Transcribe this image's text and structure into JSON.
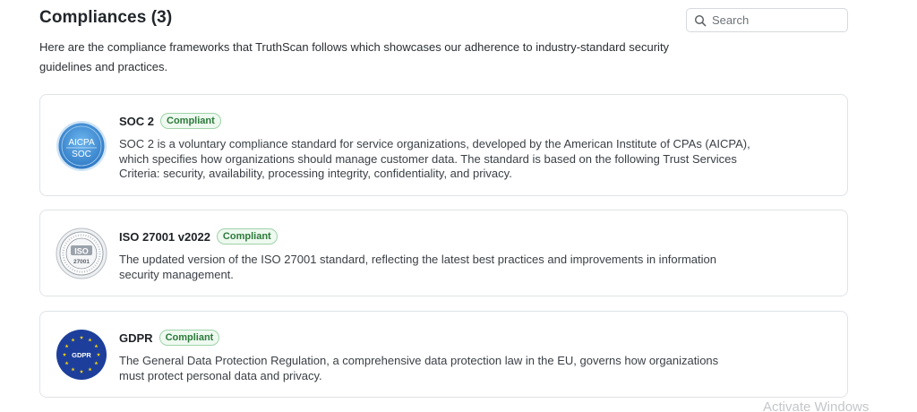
{
  "header": {
    "title": "Compliances (3)",
    "intro": "Here are the compliance frameworks that TruthScan follows which showcases our adherence to industry-standard security guidelines and practices."
  },
  "search": {
    "placeholder": "Search",
    "value": ""
  },
  "compliances": [
    {
      "name": "SOC 2",
      "status": "Compliant",
      "logo_icon": "aicpa-soc-seal-icon",
      "logo_text_top": "AICPA",
      "logo_text_bottom": "SOC",
      "description": "SOC 2 is a voluntary compliance standard for service organizations, developed by the American Institute of CPAs (AICPA), which specifies how organizations should manage customer data. The standard is based on the following Trust Services Criteria: security, availability, processing integrity, confidentiality, and privacy."
    },
    {
      "name": "ISO 27001 v2022",
      "status": "Compliant",
      "logo_icon": "iso-27001-seal-icon",
      "logo_text_top": "ISO",
      "logo_text_bottom": "27001",
      "description": "The updated version of the ISO 27001 standard, reflecting the latest best practices and improvements in information security management."
    },
    {
      "name": "GDPR",
      "status": "Compliant",
      "logo_icon": "gdpr-eu-stars-icon",
      "logo_text_top": "GDPR",
      "description": "The General Data Protection Regulation, a comprehensive data protection law in the EU, governs how organizations must protect personal data and privacy."
    }
  ],
  "watermark": "Activate Windows",
  "colors": {
    "badge_text": "#2c7a3a",
    "badge_border": "#9fd3a9",
    "soc_blue": "#3f8fd6",
    "gdpr_blue": "#1d3f9b",
    "eu_star": "#f6d10b"
  }
}
